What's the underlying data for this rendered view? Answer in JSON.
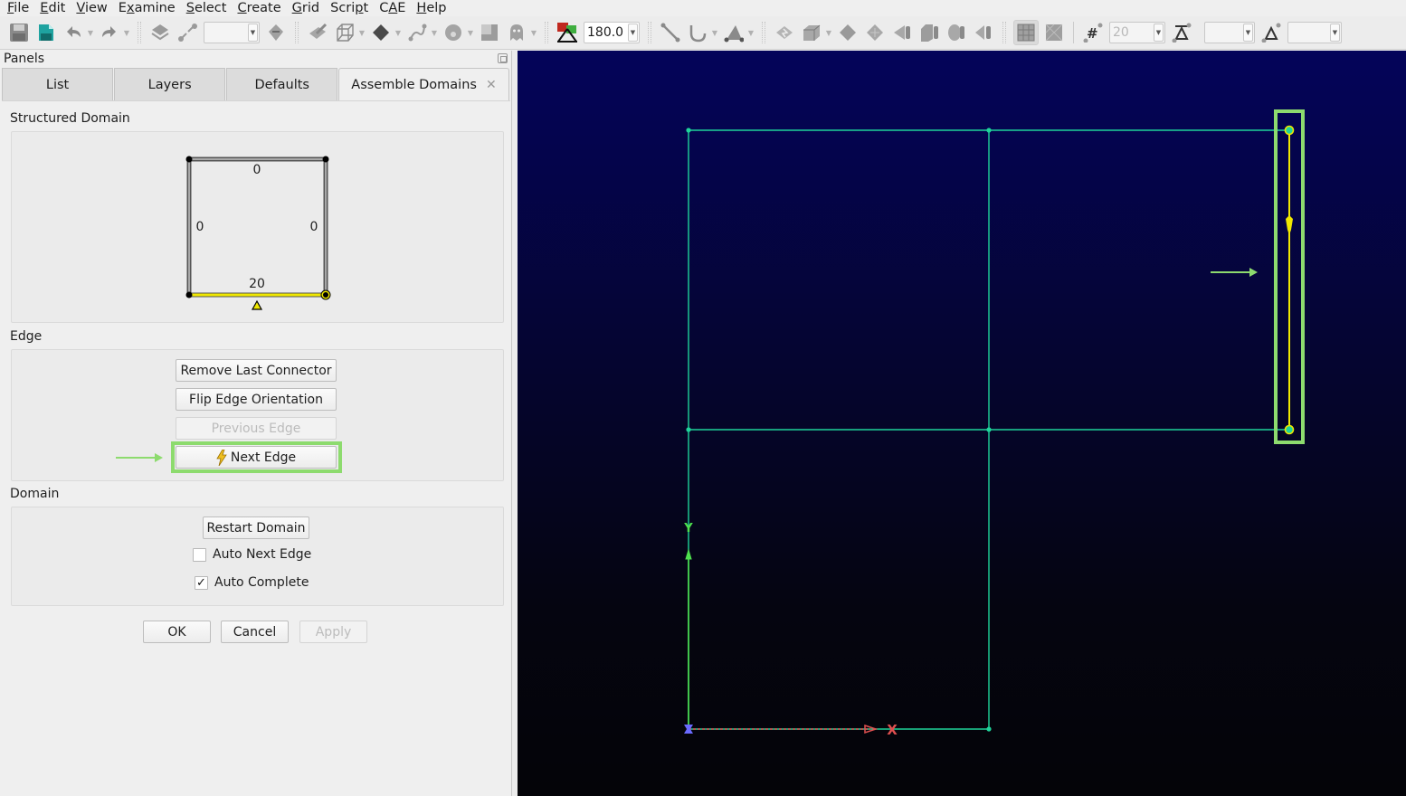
{
  "menubar": {
    "items": [
      {
        "label": "File",
        "mnemonic_index": 0
      },
      {
        "label": "Edit",
        "mnemonic_index": 0
      },
      {
        "label": "View",
        "mnemonic_index": 0
      },
      {
        "label": "Examine",
        "mnemonic_index": 1
      },
      {
        "label": "Select",
        "mnemonic_index": 0
      },
      {
        "label": "Create",
        "mnemonic_index": 0
      },
      {
        "label": "Grid",
        "mnemonic_index": 0
      },
      {
        "label": "Script",
        "mnemonic_index": 4
      },
      {
        "label": "CAE",
        "mnemonic_index": 1
      },
      {
        "label": "Help",
        "mnemonic_index": 0
      }
    ]
  },
  "toolbar": {
    "angle_value": "180.0",
    "dimension_value": "20",
    "spacing_value": "",
    "ratio_value": "",
    "layer_combo_value": "",
    "icons": [
      "save-icon",
      "save-as-icon",
      "undo-icon",
      "redo-icon",
      "mask-icon",
      "disconnect-icon",
      "rotate-icon",
      "check-icon",
      "wireframe-cube-icon",
      "shaded-surface-icon",
      "curve-icon",
      "palette-icon",
      "transparency-icon",
      "ghost-icon",
      "angle-icon",
      "line-icon",
      "conic-icon",
      "triangle-points-icon",
      "domain-assemble-icon",
      "block-assemble-icon",
      "diamond-icon",
      "quilt-icon",
      "split-icon",
      "grid-block-icon",
      "spline-icon",
      "edge-split-icon",
      "structured-grid-icon",
      "unstructured-grid-icon",
      "dimension-icon",
      "spacing-icon",
      "ratio-icon"
    ]
  },
  "panel": {
    "title": "Panels",
    "tabs": [
      {
        "label": "List",
        "active": false
      },
      {
        "label": "Layers",
        "active": false
      },
      {
        "label": "Defaults",
        "active": false
      },
      {
        "label": "Assemble Domains",
        "active": true,
        "closable": true
      }
    ],
    "structured_domain": {
      "label": "Structured Domain",
      "edges": {
        "top": "0",
        "left": "0",
        "right": "0",
        "bottom": "20"
      },
      "active_edge": "bottom",
      "colors": {
        "active": "#f0e800",
        "inactive": "#808080"
      }
    },
    "edge": {
      "label": "Edge",
      "buttons": [
        {
          "label": "Remove Last Connector",
          "enabled": true
        },
        {
          "label": "Flip Edge Orientation",
          "enabled": true
        },
        {
          "label": "Previous Edge",
          "enabled": false
        },
        {
          "label": "Next Edge",
          "enabled": true,
          "icon": "lightning-icon",
          "highlighted": true
        }
      ]
    },
    "domain": {
      "label": "Domain",
      "restart_label": "Restart Domain",
      "auto_next_edge": {
        "label": "Auto Next Edge",
        "checked": false
      },
      "auto_complete": {
        "label": "Auto Complete",
        "checked": true
      }
    },
    "footer": {
      "ok": "OK",
      "cancel": "Cancel",
      "apply": "Apply",
      "apply_enabled": false
    }
  },
  "viewport": {
    "colors": {
      "connector": "#1fd49a",
      "selected_connector": "#f0e800",
      "highlight": "#8ddb6e",
      "x_axis": "#e05050",
      "y_axis": "#4ee04e",
      "z_axis": "#6a6aff"
    },
    "axis_labels": {
      "x": "X",
      "y": "Y"
    }
  }
}
